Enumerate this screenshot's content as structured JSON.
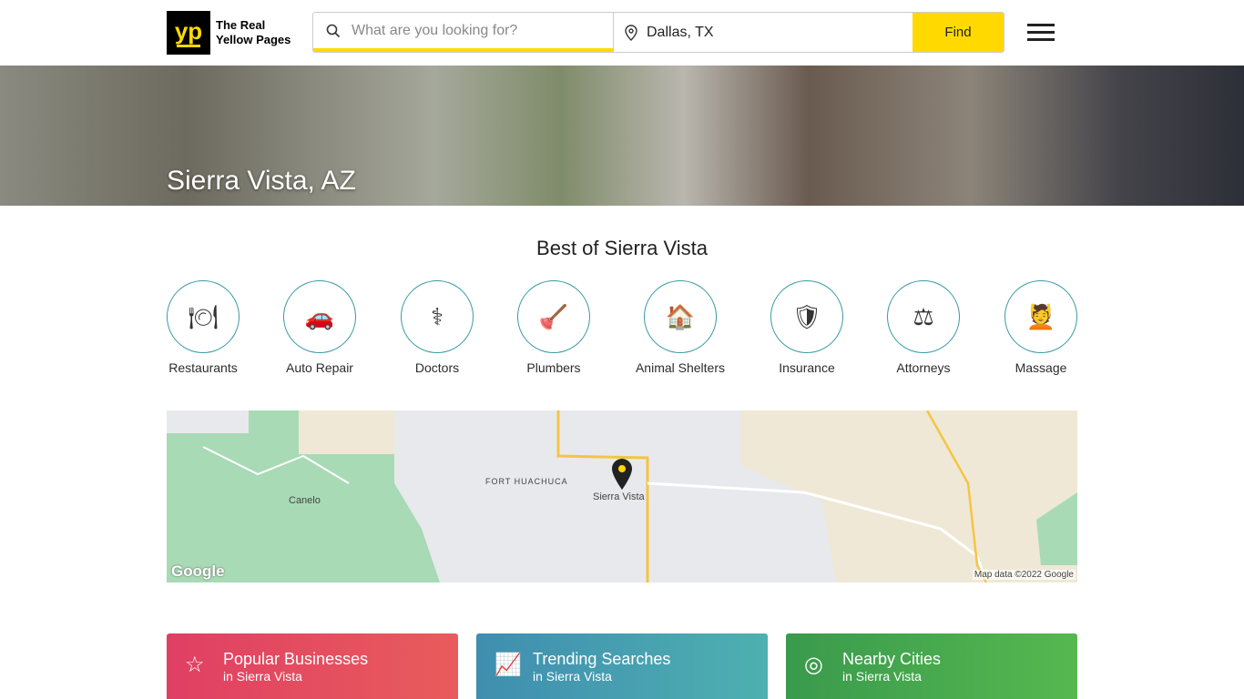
{
  "header": {
    "logo_mark": "yp",
    "logo_line1": "The Real",
    "logo_line2": "Yellow Pages",
    "search_placeholder": "What are you looking for?",
    "location_value": "Dallas, TX",
    "find_label": "Find"
  },
  "hero": {
    "title": "Sierra Vista, AZ"
  },
  "best": {
    "title": "Best of Sierra Vista",
    "categories": [
      {
        "label": "Restaurants",
        "icon": "🍽"
      },
      {
        "label": "Auto Repair",
        "icon": "🚗"
      },
      {
        "label": "Doctors",
        "icon": "⚕"
      },
      {
        "label": "Plumbers",
        "icon": "🪠"
      },
      {
        "label": "Animal Shelters",
        "icon": "🏠"
      },
      {
        "label": "Insurance",
        "icon": "🛡"
      },
      {
        "label": "Attorneys",
        "icon": "⚖"
      },
      {
        "label": "Massage",
        "icon": "💆"
      }
    ]
  },
  "map": {
    "labels": [
      "Fort Huachuca",
      "Sierra Vista",
      "Canelo"
    ],
    "routes": [
      "90",
      "90",
      "90",
      "90",
      "80"
    ],
    "attribution": "Map data ©2022 Google",
    "google": "Google"
  },
  "cards": [
    {
      "title": "Popular Businesses",
      "subtitle": "in Sierra Vista",
      "icon": "☆"
    },
    {
      "title": "Trending Searches",
      "subtitle": "in Sierra Vista",
      "icon": "📈"
    },
    {
      "title": "Nearby Cities",
      "subtitle": "in Sierra Vista",
      "icon": "◎"
    }
  ],
  "colors": {
    "brand": "#ffd900",
    "accent": "#3a9aa6"
  }
}
